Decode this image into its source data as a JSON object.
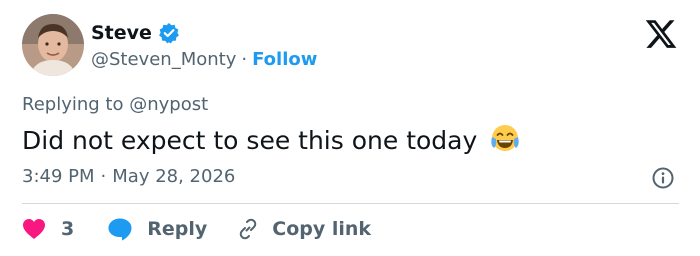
{
  "author": {
    "name": "Steve",
    "handle": "@Steven_Monty",
    "separator": "·",
    "follow_label": "Follow"
  },
  "tweet": {
    "reply_prefix": "Replying to ",
    "reply_to": "@nypost",
    "text": "Did not expect to see this one today",
    "emoji": "face-with-tears-of-joy",
    "time": "3:49 PM",
    "date": "May 28, 2026"
  },
  "actions": {
    "like_count": "3",
    "reply_label": "Reply",
    "copy_label": "Copy link"
  },
  "colors": {
    "accent": "#1d9bf0",
    "like": "#f91880",
    "text": "#0f1419",
    "muted": "#536471",
    "divider": "#cfd9de"
  }
}
